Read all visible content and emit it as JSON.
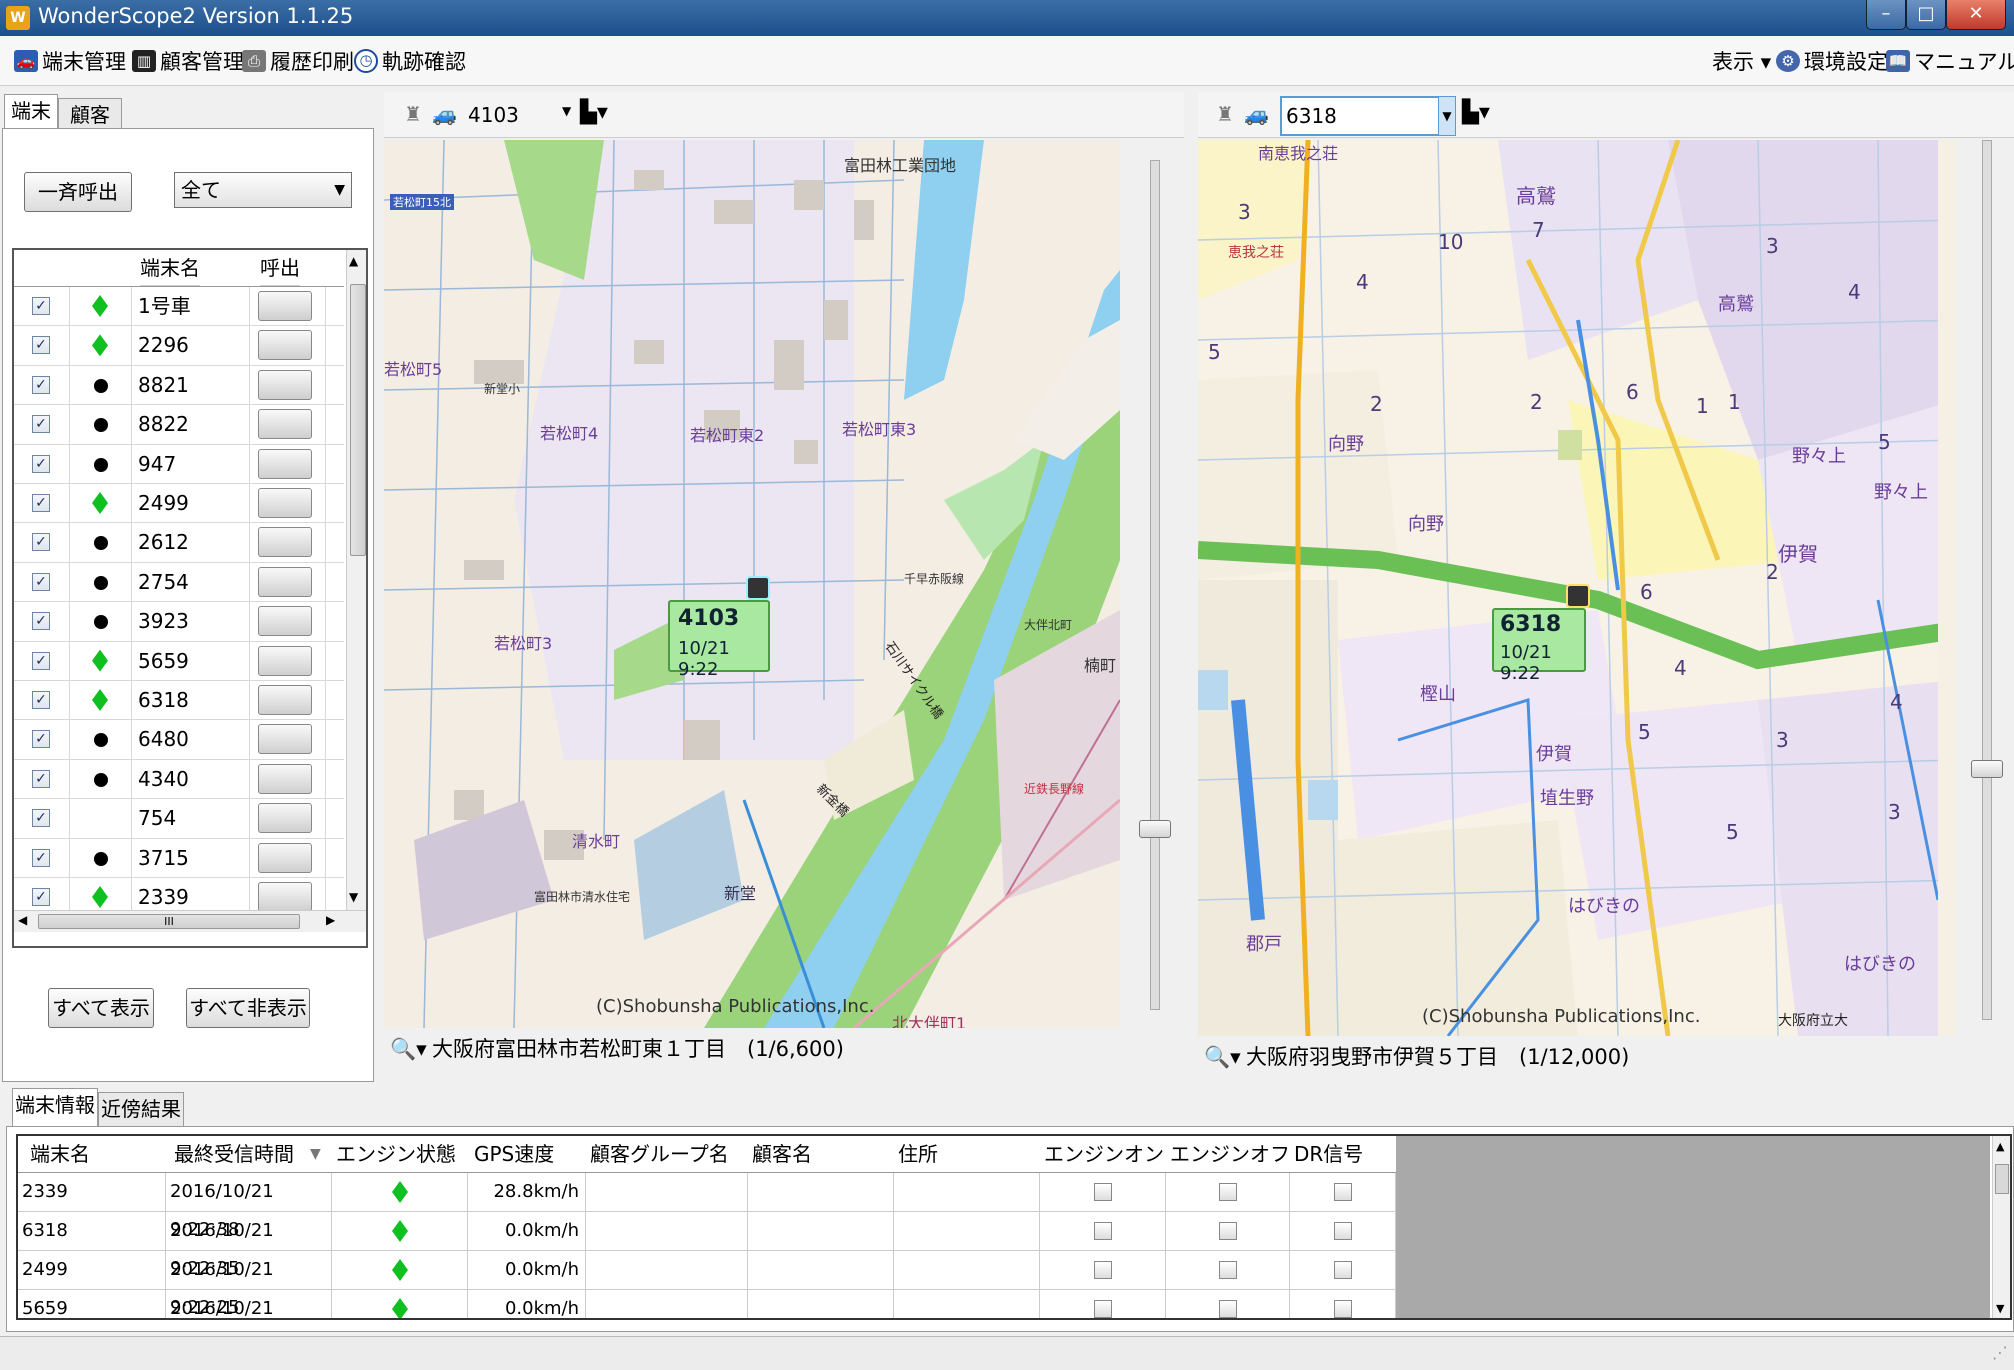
{
  "window": {
    "title": "WonderScope2 Version 1.1.25",
    "buttons": {
      "minimize": "–",
      "maximize": "□",
      "close": "✕"
    }
  },
  "toolbar": {
    "items": [
      "端末管理",
      "顧客管理",
      "履歴印刷",
      "軌跡確認"
    ],
    "right_items": [
      "表示 ▾",
      "環境設定",
      "マニュアル"
    ]
  },
  "left_panel": {
    "tabs": [
      "端末",
      "顧客"
    ],
    "call_all_button": "一斉呼出",
    "filter_select": "全て",
    "grid_headers": [
      "端末名",
      "呼出"
    ],
    "terminals": [
      {
        "checked": "✓",
        "status": "diamond",
        "name": "1号車"
      },
      {
        "checked": "✓",
        "status": "diamond",
        "name": "2296"
      },
      {
        "checked": "✓",
        "status": "dot",
        "name": "8821"
      },
      {
        "checked": "✓",
        "status": "dot",
        "name": "8822"
      },
      {
        "checked": "✓",
        "status": "dot",
        "name": "947"
      },
      {
        "checked": "✓",
        "status": "diamond",
        "name": "2499"
      },
      {
        "checked": "✓",
        "status": "dot",
        "name": "2612"
      },
      {
        "checked": "✓",
        "status": "dot",
        "name": "2754"
      },
      {
        "checked": "✓",
        "status": "dot",
        "name": "3923"
      },
      {
        "checked": "✓",
        "status": "diamond",
        "name": "5659"
      },
      {
        "checked": "✓",
        "status": "diamond",
        "name": "6318"
      },
      {
        "checked": "✓",
        "status": "dot",
        "name": "6480"
      },
      {
        "checked": "✓",
        "status": "dot",
        "name": "4340"
      },
      {
        "checked": "✓",
        "status": "none",
        "name": "754"
      },
      {
        "checked": "✓",
        "status": "dot",
        "name": "3715"
      },
      {
        "checked": "✓",
        "status": "diamond",
        "name": "2339"
      }
    ],
    "hscroll_label": "III",
    "show_all_button": "すべて表示",
    "hide_all_button": "すべて非表示"
  },
  "map_left": {
    "vehicle_select": "4103",
    "vehicle": {
      "id": "4103",
      "time": "10/21 9:22"
    },
    "labels": [
      "富田林工業団地",
      "若松町5",
      "若松町4",
      "若松町東2",
      "若松町東3",
      "若松町3",
      "清水町",
      "新堂",
      "新堂小",
      "千早赤阪線",
      "楠町",
      "石川サイクル橋",
      "新金橋",
      "北大伴町1",
      "大伴北町",
      "近鉄長野線",
      "若松町15北",
      "富田林市清水住宅"
    ],
    "copyright": "(C)Shobunsha Publications,Inc.",
    "status": "大阪府富田林市若松町東１丁目　(1/6,600)"
  },
  "map_right": {
    "vehicle_select": "6318",
    "vehicle": {
      "id": "6318",
      "time": "10/21 9:22"
    },
    "labels": [
      "南恵我之荘",
      "高鷲",
      "向野",
      "向野",
      "伊賀",
      "野々上",
      "野々上",
      "高鷲",
      "はびきの",
      "はびきの",
      "郡戸",
      "埴生野",
      "伊賀",
      "樫山",
      "恵我之荘",
      "大阪府立大"
    ],
    "numbers": [
      "3",
      "5",
      "10",
      "4",
      "6",
      "1",
      "2",
      "7",
      "3",
      "4",
      "5",
      "2",
      "3",
      "4",
      "5",
      "6",
      "4",
      "2",
      "1",
      "5",
      "3"
    ],
    "copyright": "(C)Shobunsha Publications,Inc.",
    "status": "大阪府羽曳野市伊賀５丁目　(1/12,000)"
  },
  "bottom": {
    "tabs": [
      "端末情報",
      "近傍結果"
    ],
    "headers": [
      "端末名",
      "最終受信時間",
      "エンジン状態",
      "GPS速度",
      "顧客グループ名",
      "顧客名",
      "住所",
      "エンジンオン",
      "エンジンオフ",
      "DR信号"
    ],
    "sort_indicator": "▼",
    "rows": [
      {
        "name": "2339",
        "time": "2016/10/21 9:22:38",
        "speed": "28.8km/h"
      },
      {
        "name": "6318",
        "time": "2016/10/21 9:22:35",
        "speed": "0.0km/h"
      },
      {
        "name": "2499",
        "time": "2016/10/21 9:22:25",
        "speed": "0.0km/h"
      },
      {
        "name": "5659",
        "time": "2016/10/21 9:22:21",
        "speed": "0.0km/h"
      }
    ]
  }
}
